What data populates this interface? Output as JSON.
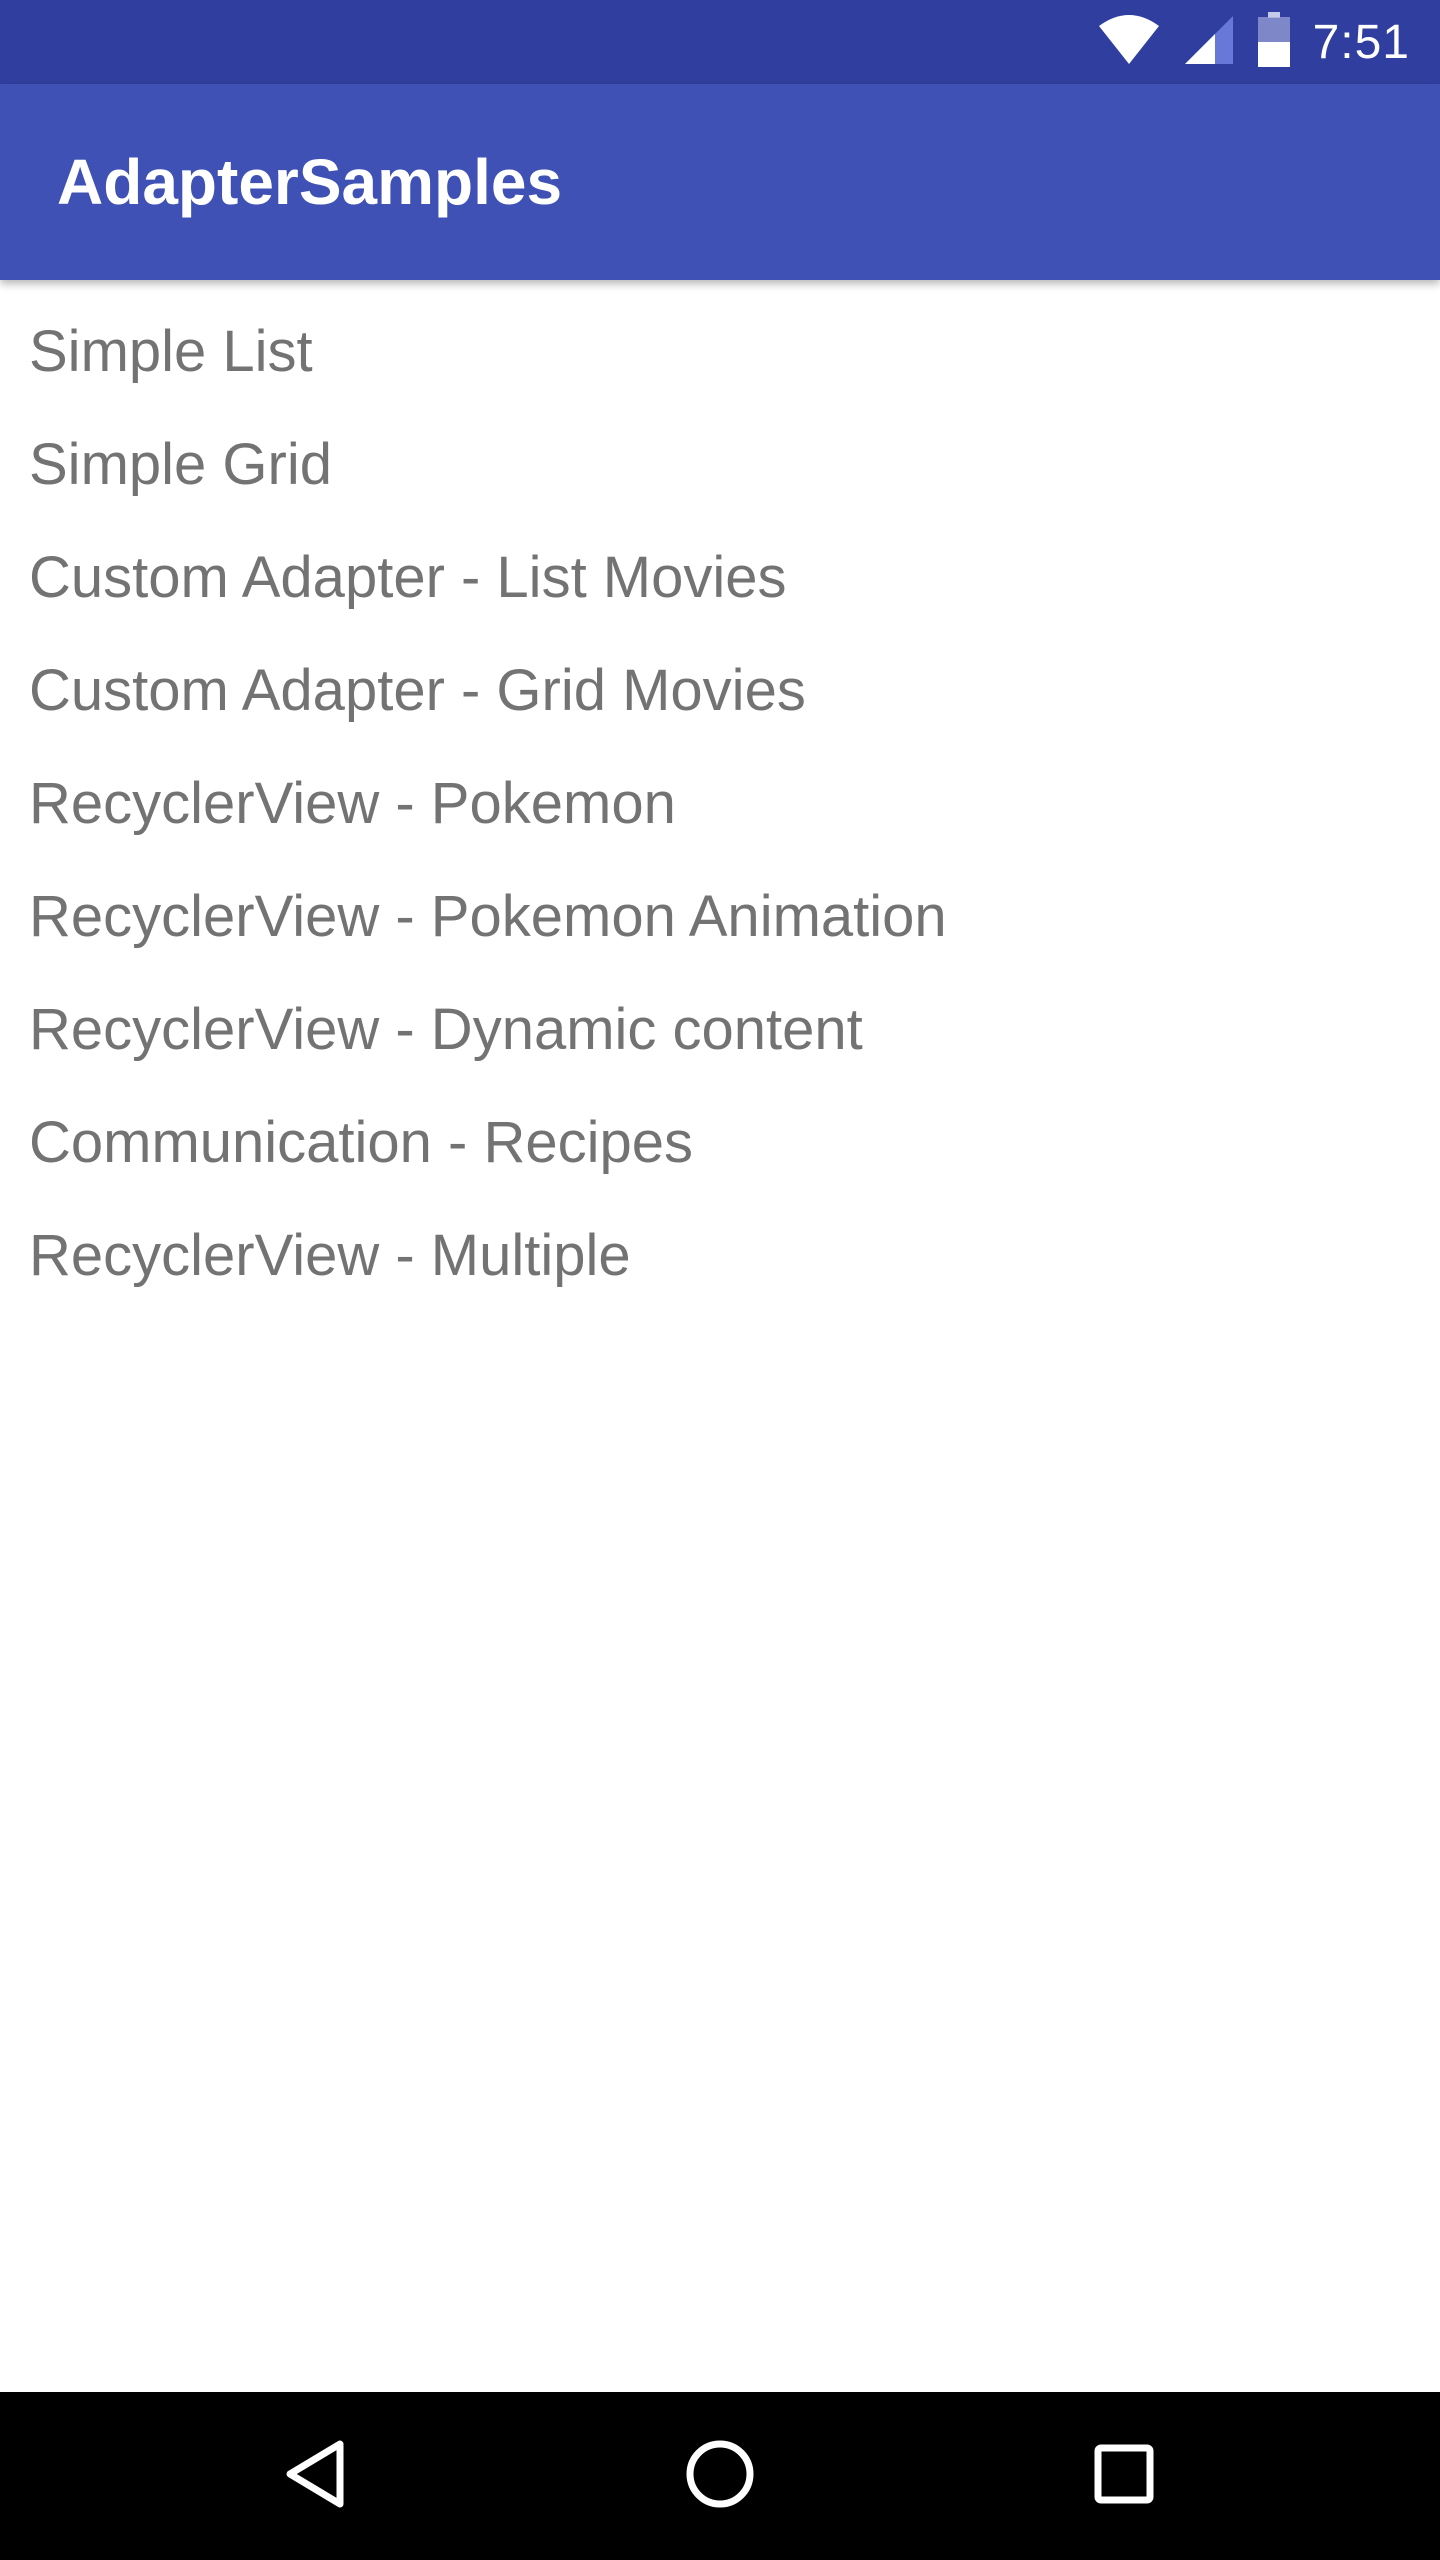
{
  "status_bar": {
    "time": "7:51",
    "icons": [
      "wifi-icon",
      "cellular-signal-icon",
      "battery-icon"
    ],
    "background_color": "#303f9f"
  },
  "app_bar": {
    "title": "AdapterSamples",
    "background_color": "#3f51b5"
  },
  "list": {
    "items": [
      {
        "label": "Simple List"
      },
      {
        "label": "Simple Grid"
      },
      {
        "label": "Custom Adapter - List Movies"
      },
      {
        "label": "Custom Adapter - Grid Movies"
      },
      {
        "label": "RecyclerView - Pokemon"
      },
      {
        "label": "RecyclerView - Pokemon Animation"
      },
      {
        "label": "RecyclerView - Dynamic content"
      },
      {
        "label": "Communication - Recipes"
      },
      {
        "label": "RecyclerView - Multiple"
      }
    ],
    "text_color": "#737373"
  },
  "nav_bar": {
    "buttons": [
      "back-icon",
      "home-icon",
      "recents-icon"
    ],
    "background_color": "#000000"
  }
}
